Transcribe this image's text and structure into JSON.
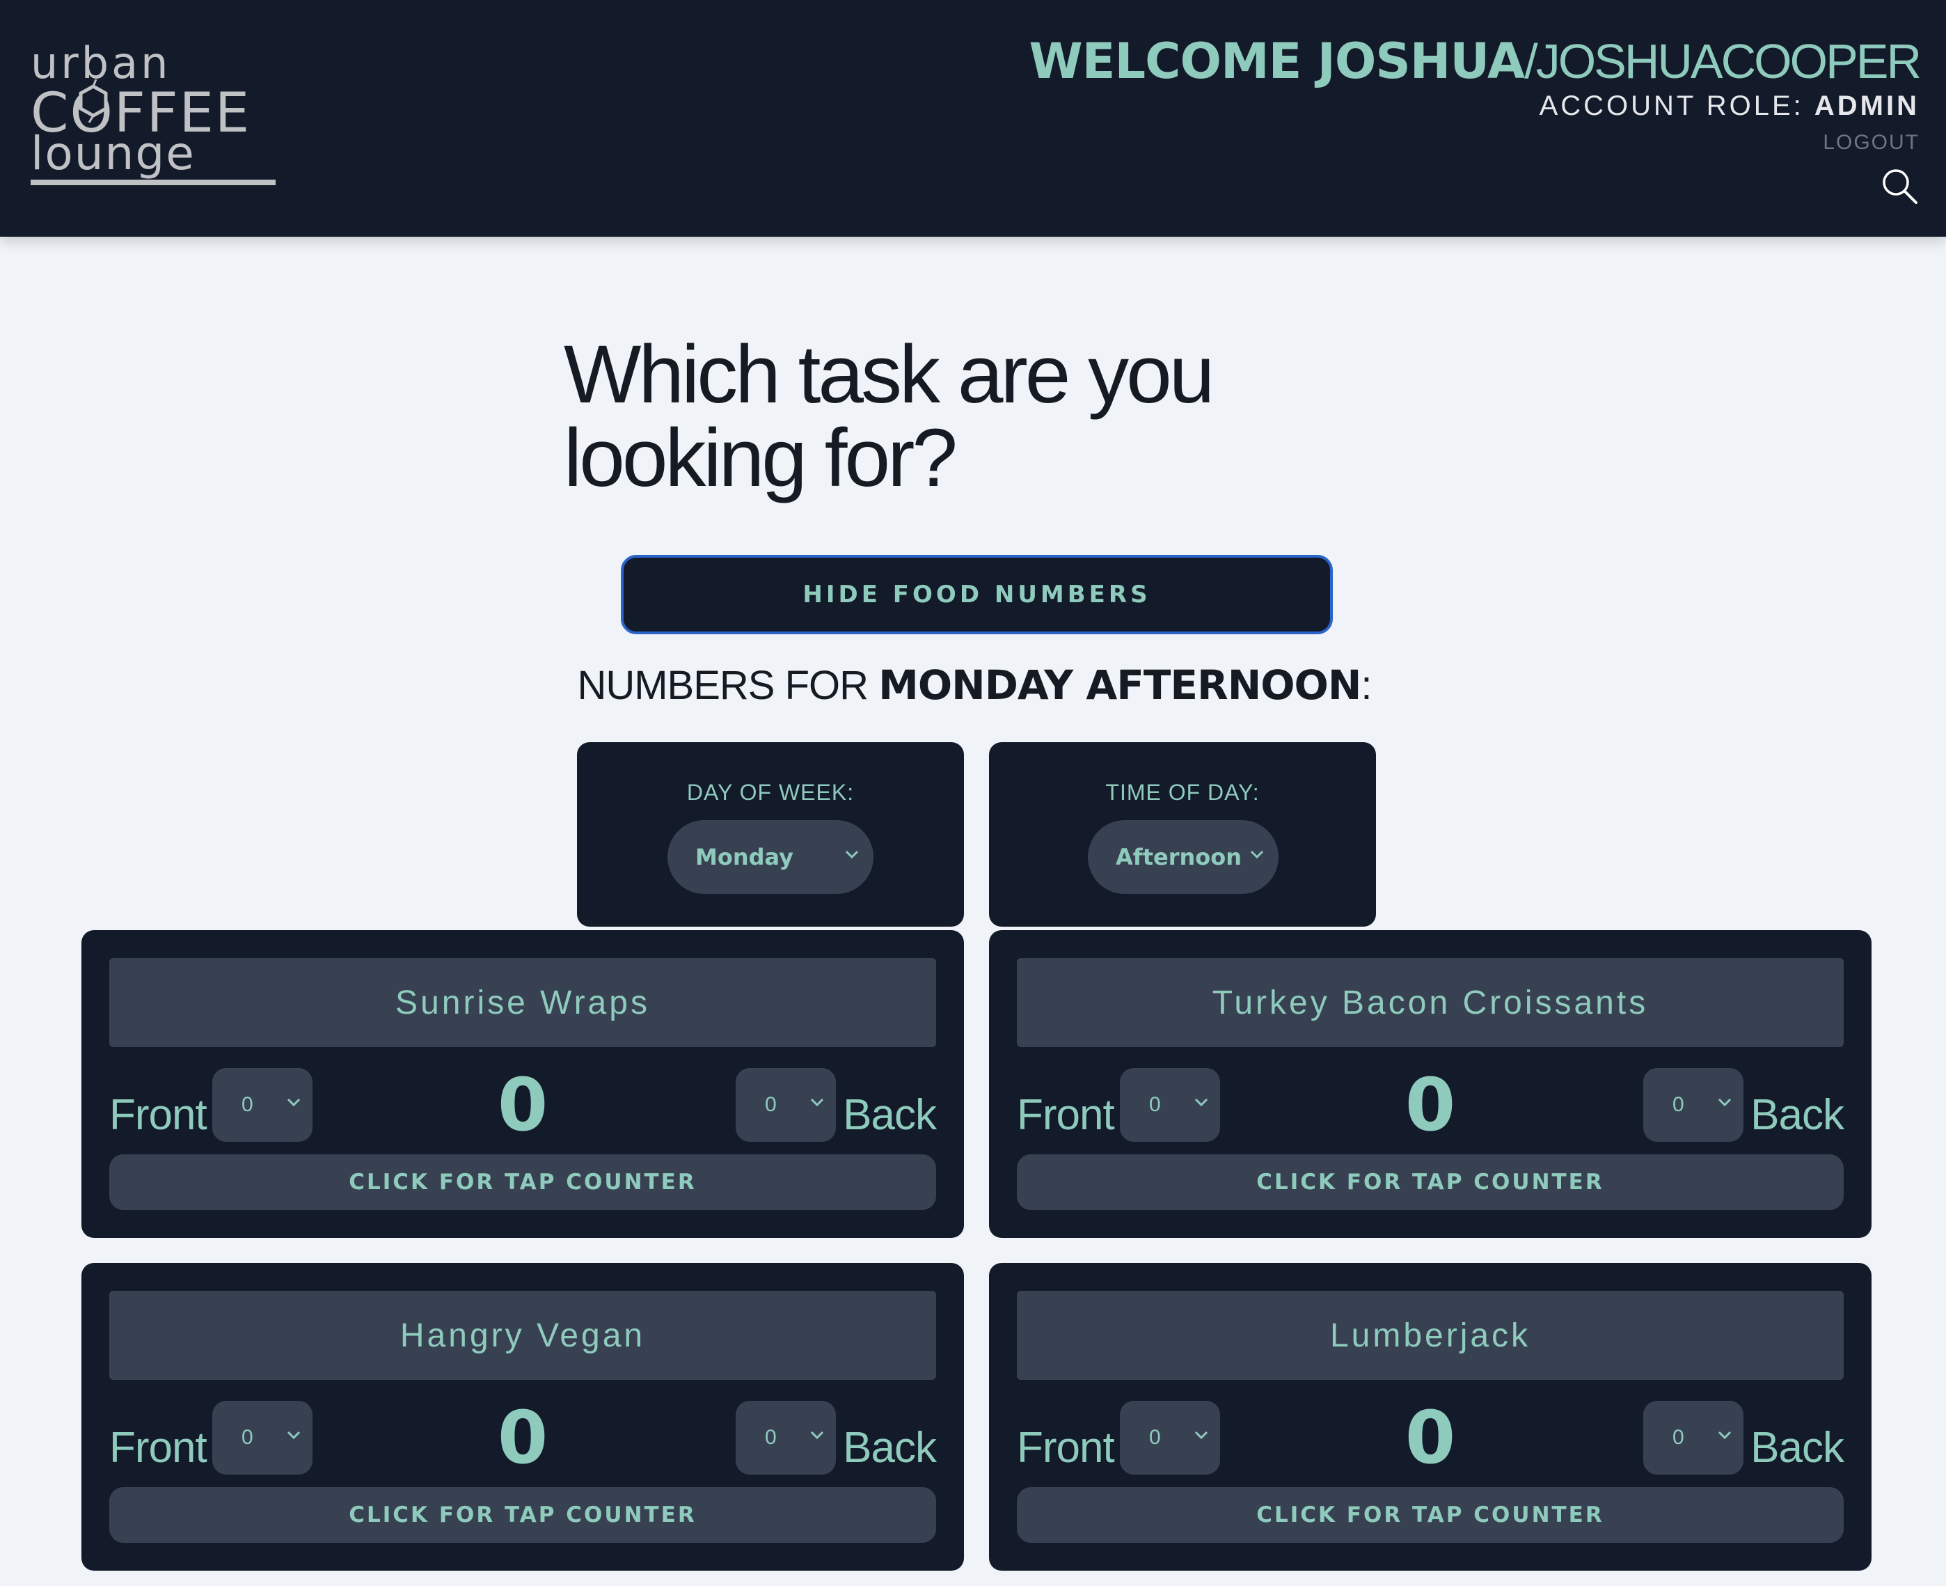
{
  "header": {
    "logo": {
      "line1": "urban",
      "line2": "COFFEE",
      "line3": "lounge"
    },
    "welcome_name": "WELCOME JOSHUA",
    "welcome_separator": "/",
    "username": "JOSHUACOOPER",
    "role_label": "ACCOUNT ROLE:",
    "role_value": "ADMIN",
    "logout_label": "LOGOUT",
    "search_icon": "search-icon"
  },
  "main": {
    "question_line1": "Which task are you",
    "question_line2": "looking for?",
    "hide_button": "HIDE FOOD NUMBERS",
    "numbers_prefix": "NUMBERS FOR ",
    "numbers_day_time": "MONDAY AFTERNOON",
    "numbers_suffix": ":",
    "day_selector": {
      "label": "DAY OF WEEK:",
      "value": "Monday"
    },
    "time_selector": {
      "label": "TIME OF DAY:",
      "value": "Afternoon"
    }
  },
  "food_items": [
    {
      "name": "Sunrise Wraps",
      "front_label": "Front",
      "front_value": "0",
      "total": "0",
      "back_value": "0",
      "back_label": "Back",
      "tap_label": "CLICK FOR TAP COUNTER"
    },
    {
      "name": "Turkey Bacon Croissants",
      "front_label": "Front",
      "front_value": "0",
      "total": "0",
      "back_value": "0",
      "back_label": "Back",
      "tap_label": "CLICK FOR TAP COUNTER"
    },
    {
      "name": "Hangry Vegan",
      "front_label": "Front",
      "front_value": "0",
      "total": "0",
      "back_value": "0",
      "back_label": "Back",
      "tap_label": "CLICK FOR TAP COUNTER"
    },
    {
      "name": "Lumberjack",
      "front_label": "Front",
      "front_value": "0",
      "total": "0",
      "back_value": "0",
      "back_label": "Back",
      "tap_label": "CLICK FOR TAP COUNTER"
    }
  ],
  "colors": {
    "header_bg": "#131a29",
    "accent": "#8fcbbd",
    "panel": "#384152",
    "page_bg": "#f0f4f9",
    "button_border": "#2a63c9"
  }
}
